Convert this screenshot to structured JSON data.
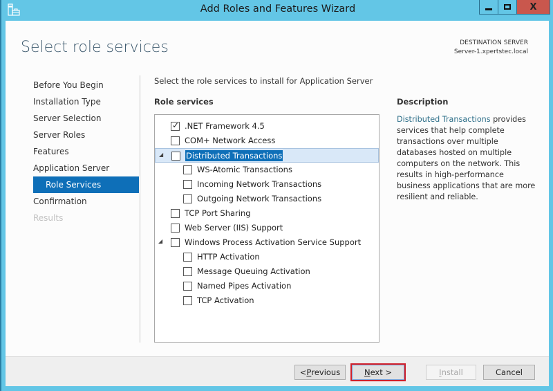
{
  "window": {
    "title": "Add Roles and Features Wizard",
    "app_icon": "server-manager-icon",
    "controls": {
      "minimize": "minimize-icon",
      "maximize": "maximize-icon",
      "close": "close-icon",
      "close_glyph": "X"
    }
  },
  "header": {
    "page_title": "Select role services",
    "destination_label": "DESTINATION SERVER",
    "destination_server": "Server-1.xpertstec.local"
  },
  "nav": {
    "items": [
      {
        "label": "Before You Begin",
        "state": "normal"
      },
      {
        "label": "Installation Type",
        "state": "normal"
      },
      {
        "label": "Server Selection",
        "state": "normal"
      },
      {
        "label": "Server Roles",
        "state": "normal"
      },
      {
        "label": "Features",
        "state": "normal"
      },
      {
        "label": "Application Server",
        "state": "normal"
      },
      {
        "label": "Role Services",
        "state": "active"
      },
      {
        "label": "Confirmation",
        "state": "normal"
      },
      {
        "label": "Results",
        "state": "disabled"
      }
    ]
  },
  "content": {
    "prompt": "Select the role services to install for Application Server",
    "role_services_label": "Role services",
    "tree": [
      {
        "label": ".NET Framework 4.5",
        "level": 0,
        "checked": true,
        "expander": false,
        "selected": false
      },
      {
        "label": "COM+ Network Access",
        "level": 0,
        "checked": false,
        "expander": false,
        "selected": false
      },
      {
        "label": "Distributed Transactions",
        "level": 0,
        "checked": false,
        "expander": true,
        "selected": true
      },
      {
        "label": "WS-Atomic Transactions",
        "level": 1,
        "checked": false,
        "expander": false,
        "selected": false
      },
      {
        "label": "Incoming Network Transactions",
        "level": 1,
        "checked": false,
        "expander": false,
        "selected": false
      },
      {
        "label": "Outgoing Network Transactions",
        "level": 1,
        "checked": false,
        "expander": false,
        "selected": false
      },
      {
        "label": "TCP Port Sharing",
        "level": 0,
        "checked": false,
        "expander": false,
        "selected": false
      },
      {
        "label": "Web Server (IIS) Support",
        "level": 0,
        "checked": false,
        "expander": false,
        "selected": false
      },
      {
        "label": "Windows Process Activation Service Support",
        "level": 0,
        "checked": false,
        "expander": true,
        "selected": false
      },
      {
        "label": "HTTP Activation",
        "level": 1,
        "checked": false,
        "expander": false,
        "selected": false
      },
      {
        "label": "Message Queuing Activation",
        "level": 1,
        "checked": false,
        "expander": false,
        "selected": false
      },
      {
        "label": "Named Pipes Activation",
        "level": 1,
        "checked": false,
        "expander": false,
        "selected": false
      },
      {
        "label": "TCP Activation",
        "level": 1,
        "checked": false,
        "expander": false,
        "selected": false
      }
    ],
    "expander_glyph": "◢",
    "check_glyph": "✓"
  },
  "description": {
    "heading": "Description",
    "link_text": "Distributed Transactions",
    "body": " provides services that help complete transactions over multiple databases hosted on multiple computers on the network. This results in high-performance business applications that are more resilient and reliable."
  },
  "footer": {
    "previous": {
      "prefix": "< ",
      "mnemonic": "P",
      "rest": "revious"
    },
    "next": {
      "mnemonic": "N",
      "rest": "ext >"
    },
    "install": {
      "mnemonic": "I",
      "rest": "nstall",
      "enabled": false
    },
    "cancel": "Cancel"
  },
  "colors": {
    "frame": "#63c6e6",
    "accent": "#0e6fb8",
    "close_button": "#c9574d",
    "selection_row": "#d9e8f8",
    "highlight_outline": "#d0202a",
    "link": "#2e6f89"
  }
}
